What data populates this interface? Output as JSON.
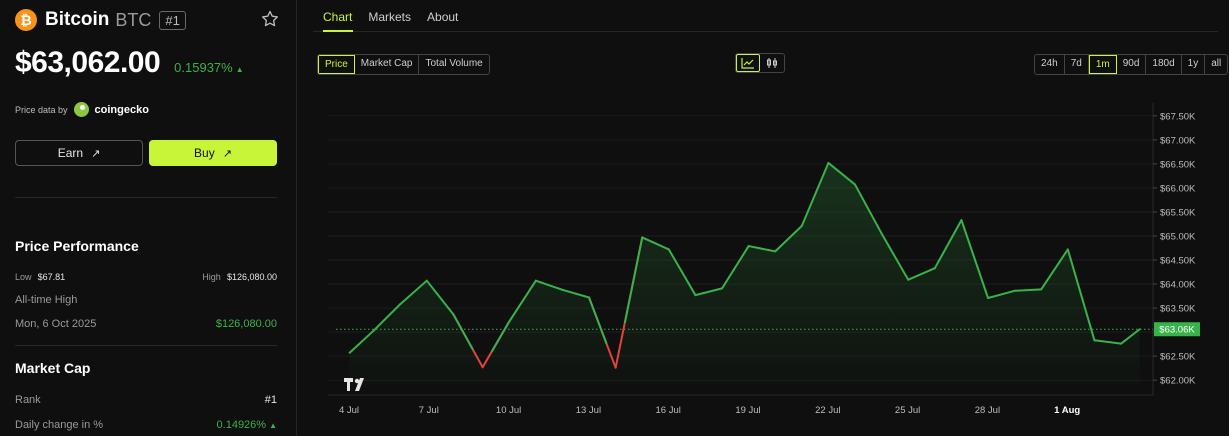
{
  "coin": {
    "name": "Bitcoin",
    "symbol": "BTC",
    "rank_badge": "#1",
    "price": "$63,062.00",
    "change": "0.15937%",
    "price_data_label": "Price data by",
    "provider": "coingecko"
  },
  "buttons": {
    "earn": "Earn",
    "buy": "Buy"
  },
  "performance": {
    "title": "Price Performance",
    "low_label": "Low",
    "low_value": "$67.81",
    "high_label": "High",
    "high_value": "$126,080.00",
    "ath_label": "All-time High",
    "ath_date": "Mon, 6 Oct 2025",
    "ath_value": "$126,080.00"
  },
  "market_cap": {
    "title": "Market Cap",
    "rank_label": "Rank",
    "rank_value": "#1",
    "daily_label": "Daily change in %",
    "daily_value": "0.14926%"
  },
  "tabs": [
    "Chart",
    "Markets",
    "About"
  ],
  "metrics": [
    "Price",
    "Market Cap",
    "Total Volume"
  ],
  "ranges": [
    "24h",
    "7d",
    "1m",
    "90d",
    "180d",
    "1y",
    "all"
  ],
  "colors": {
    "accent": "#c8f538",
    "up": "#38b24a",
    "down": "#e0443c"
  },
  "chart_data": {
    "type": "line",
    "current_label": "$63.06K",
    "current_value": 63060,
    "ylim": [
      61900,
      67600
    ],
    "y_ticks": [
      67500,
      67000,
      66500,
      66000,
      65500,
      65000,
      64500,
      64000,
      63500,
      63000,
      62500,
      62000
    ],
    "y_tick_labels": [
      "$67.50K",
      "$67.00K",
      "$66.50K",
      "$66.00K",
      "$65.50K",
      "$65.00K",
      "$64.50K",
      "$64.00K",
      "$63.50K",
      "$63.00K",
      "$62.50K",
      "$62.00K"
    ],
    "x_ticks": [
      0,
      3,
      6,
      9,
      12,
      15,
      18,
      21,
      24,
      27
    ],
    "x_tick_labels": [
      "4 Jul",
      "7 Jul",
      "10 Jul",
      "13 Jul",
      "16 Jul",
      "19 Jul",
      "22 Jul",
      "25 Jul",
      "28 Jul",
      "1 Aug"
    ],
    "x_domain": [
      0,
      30
    ],
    "points": [
      [
        0.4,
        62570
      ],
      [
        1.3,
        63030
      ],
      [
        2.3,
        63580
      ],
      [
        3.3,
        64070
      ],
      [
        4.3,
        63370
      ],
      [
        5.4,
        62270
      ],
      [
        6.4,
        63220
      ],
      [
        7.4,
        64070
      ],
      [
        8.4,
        63880
      ],
      [
        9.4,
        63720
      ],
      [
        10.4,
        62260
      ],
      [
        11.4,
        64970
      ],
      [
        12.4,
        64720
      ],
      [
        13.4,
        63770
      ],
      [
        14.4,
        63910
      ],
      [
        15.4,
        64790
      ],
      [
        16.4,
        64680
      ],
      [
        17.4,
        65210
      ],
      [
        18.4,
        66520
      ],
      [
        19.4,
        66070
      ],
      [
        20.4,
        65050
      ],
      [
        21.4,
        64090
      ],
      [
        22.4,
        64330
      ],
      [
        23.4,
        65330
      ],
      [
        24.4,
        63710
      ],
      [
        25.4,
        63860
      ],
      [
        26.4,
        63890
      ],
      [
        27.4,
        64720
      ],
      [
        28.4,
        62830
      ],
      [
        29.4,
        62760
      ],
      [
        30.1,
        63060
      ]
    ],
    "down_points": [
      5,
      10
    ]
  }
}
